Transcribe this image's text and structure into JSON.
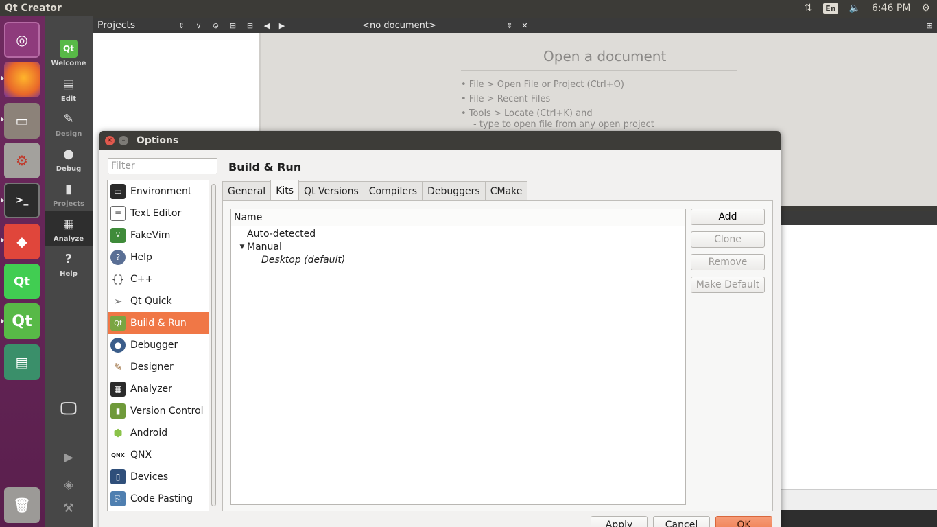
{
  "topbar": {
    "app_title": "Qt Creator",
    "input_indicator": "En",
    "clock": "6:46 PM"
  },
  "launcher": {
    "items": [
      {
        "name": "Ubuntu",
        "color": "#8e3b7c"
      },
      {
        "name": "Firefox",
        "color": "#e8672a"
      },
      {
        "name": "Files",
        "color": "#8c8279"
      },
      {
        "name": "Settings",
        "color": "#a3a19d"
      },
      {
        "name": "Terminal",
        "color": "#2c2c2c"
      },
      {
        "name": "AnyDesk",
        "color": "#e0463b"
      },
      {
        "name": "Qt",
        "color": "#41cd52"
      },
      {
        "name": "Qt Creator",
        "color": "#58b947"
      },
      {
        "name": "Serial",
        "color": "#3a8f6a"
      },
      {
        "name": "Trash",
        "color": "#9c9a97"
      }
    ]
  },
  "modes": {
    "welcome": "Welcome",
    "edit": "Edit",
    "design": "Design",
    "debug": "Debug",
    "projects": "Projects",
    "analyze": "Analyze",
    "help": "Help"
  },
  "projects_panel": {
    "selector": "Projects"
  },
  "editor": {
    "document": "<no document>",
    "open_title": "Open a document",
    "hints": [
      "• File > Open File or Project (Ctrl+O)",
      "• File > Recent Files",
      "• Tools > Locate (Ctrl+K) and",
      "- type to open file from any open project"
    ]
  },
  "dialog": {
    "title": "Options",
    "filter_placeholder": "Filter",
    "section_title": "Build & Run",
    "categories": [
      {
        "label": "Environment",
        "icon": "monitor-icon",
        "color": "#2b2b2b"
      },
      {
        "label": "Text Editor",
        "icon": "text-editor-icon",
        "color": "#6b6b6b"
      },
      {
        "label": "FakeVim",
        "icon": "fakevim-icon",
        "color": "#3f8b3a"
      },
      {
        "label": "Help",
        "icon": "help-icon",
        "color": "#5a6f95"
      },
      {
        "label": "C++",
        "icon": "cpp-braces-icon",
        "color": "#555555"
      },
      {
        "label": "Qt Quick",
        "icon": "paper-plane-icon",
        "color": "#8a8a8a"
      },
      {
        "label": "Build & Run",
        "icon": "qt-build-icon",
        "color": "#7aa542"
      },
      {
        "label": "Debugger",
        "icon": "debugger-bug-icon",
        "color": "#3b5d8a"
      },
      {
        "label": "Designer",
        "icon": "designer-icon",
        "color": "#9a6b3a"
      },
      {
        "label": "Analyzer",
        "icon": "analyzer-icon",
        "color": "#2b2b2b"
      },
      {
        "label": "Version Control",
        "icon": "version-control-icon",
        "color": "#6f9a3a"
      },
      {
        "label": "Android",
        "icon": "android-icon",
        "color": "#8bc34a"
      },
      {
        "label": "QNX",
        "icon": "qnx-icon",
        "color": "#222222"
      },
      {
        "label": "Devices",
        "icon": "devices-icon",
        "color": "#2f4f7a"
      },
      {
        "label": "Code Pasting",
        "icon": "code-pasting-icon",
        "color": "#4f7fb0"
      }
    ],
    "tabs": [
      "General",
      "Kits",
      "Qt Versions",
      "Compilers",
      "Debuggers",
      "CMake"
    ],
    "active_tab": "Kits",
    "kits": {
      "column_header": "Name",
      "group_auto": "Auto-detected",
      "group_manual": "Manual",
      "manual_kit": "Desktop (default)"
    },
    "buttons": {
      "add": "Add",
      "clone": "Clone",
      "remove": "Remove",
      "make_default": "Make Default",
      "apply": "Apply",
      "cancel": "Cancel",
      "ok": "OK"
    }
  }
}
